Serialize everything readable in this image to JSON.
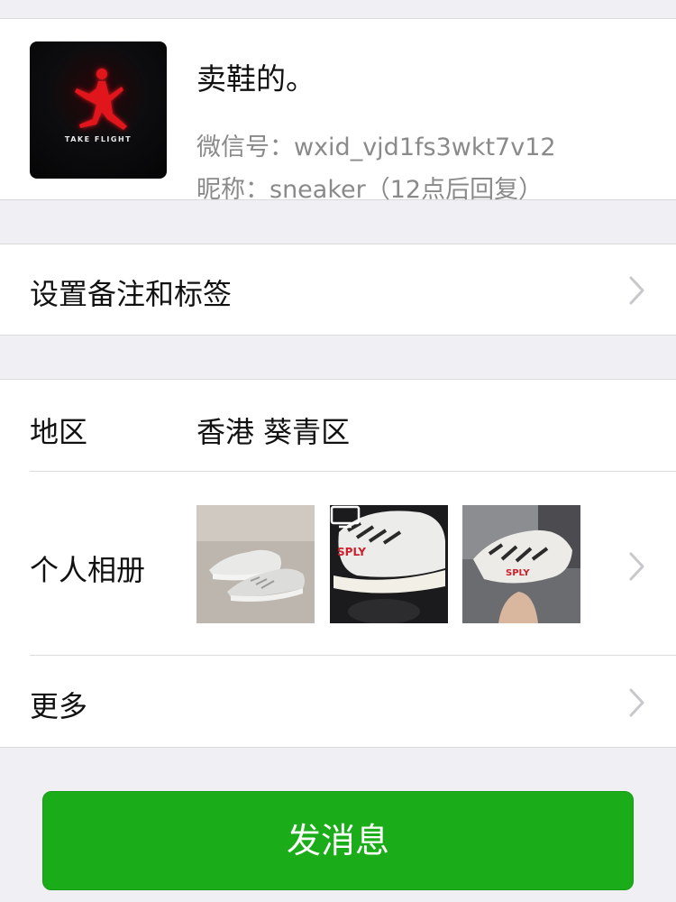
{
  "profile": {
    "avatar_icon": "jumpman-logo-icon",
    "avatar_caption": "TAKE FLIGHT",
    "name": "卖鞋的。",
    "wechat_id": "微信号：wxid_vjd1fs3wkt7v12",
    "nickname": "昵称：sneaker（12点后回复）"
  },
  "remark": {
    "label": "设置备注和标签"
  },
  "details": {
    "region_label": "地区",
    "region_value": "香港 葵青区",
    "album_label": "个人相册",
    "more_label": "更多"
  },
  "send_button": {
    "label": "发消息"
  },
  "colors": {
    "background": "#efeff4",
    "primary_green": "#1aad19",
    "secondary_text": "#8a8a8a"
  }
}
